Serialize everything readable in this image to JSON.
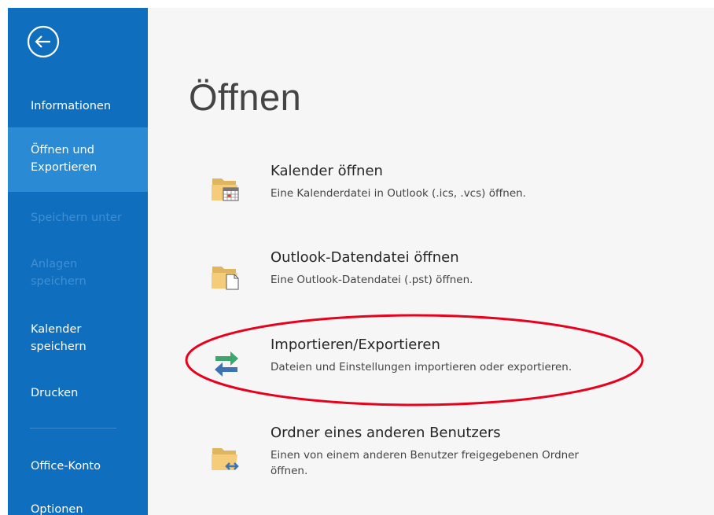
{
  "sidebar": {
    "items": [
      {
        "label_lines": [
          "Informationen"
        ],
        "state": "normal"
      },
      {
        "label_lines": [
          "Öffnen und",
          "Exportieren"
        ],
        "state": "active"
      },
      {
        "label_lines": [
          "Speichern unter"
        ],
        "state": "disabled"
      },
      {
        "label_lines": [
          "Anlagen",
          "speichern"
        ],
        "state": "disabled"
      },
      {
        "label_lines": [
          "Kalender",
          "speichern"
        ],
        "state": "normal"
      },
      {
        "label_lines": [
          "Drucken"
        ],
        "state": "normal"
      },
      {
        "label_lines": [
          "Office-Konto"
        ],
        "state": "normal"
      },
      {
        "label_lines": [
          "Optionen"
        ],
        "state": "normal"
      }
    ]
  },
  "main": {
    "title": "Öffnen",
    "options": [
      {
        "icon": "folder-calendar-icon",
        "title": "Kalender öffnen",
        "desc_lines": [
          "Eine Kalenderdatei in Outlook (.ics, .vcs) öffnen."
        ]
      },
      {
        "icon": "folder-file-icon",
        "title": "Outlook-Datendatei öffnen",
        "desc_lines": [
          "Eine Outlook-Datendatei (.pst) öffnen."
        ]
      },
      {
        "icon": "import-export-arrows-icon",
        "title": "Importieren/Exportieren",
        "desc_lines": [
          "Dateien und Einstellungen importieren oder exportieren."
        ]
      },
      {
        "icon": "folder-shared-icon",
        "title": "Ordner eines anderen Benutzers",
        "desc_lines": [
          "Einen von einem anderen Benutzer freigegebenen Ordner",
          "öffnen."
        ]
      }
    ]
  },
  "colors": {
    "sidebar_bg": "#106ebe",
    "sidebar_active": "#2a8ad4",
    "highlight_ellipse": "#e8001c"
  }
}
